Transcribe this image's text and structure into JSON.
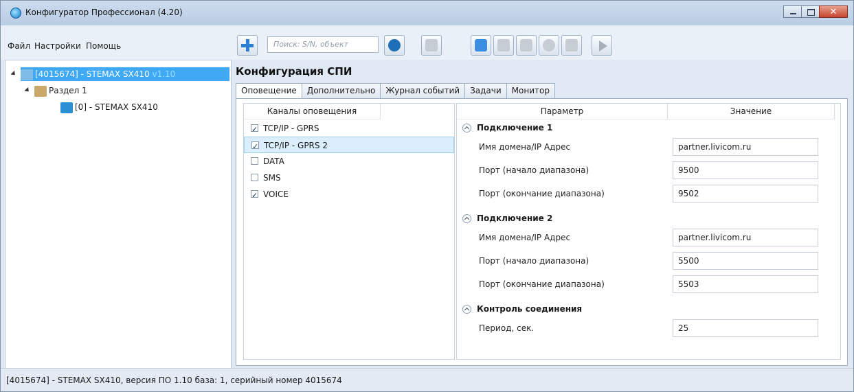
{
  "window": {
    "title": "Конфигуратор Профессионал (4.20)"
  },
  "menu": [
    "Файл",
    "Настройки",
    "Помощь"
  ],
  "toolbar": {
    "search_placeholder": "Поиск: S/N, объект",
    "icons": [
      "add-icon",
      "search-device-icon",
      "users-icon",
      "usb-icon",
      "ethernet-icon",
      "wifi-icon",
      "globe-icon",
      "modem-icon",
      "play-icon"
    ]
  },
  "tree": {
    "device": {
      "label": "[4015674] - STEMAX SX410",
      "version": "v1.10"
    },
    "section": "Раздел 1",
    "object": "[0] - STEMAX SX410"
  },
  "main": {
    "title": "Конфигурация СПИ",
    "tabs": [
      "Оповещение",
      "Дополнительно",
      "Журнал событий",
      "Задачи",
      "Монитор"
    ],
    "active_tab": "Оповещение"
  },
  "channels": {
    "header": "Каналы оповещения",
    "items": [
      {
        "label": "TCP/IP - GPRS",
        "checked": true
      },
      {
        "label": "TCP/IP - GPRS 2",
        "checked": true
      },
      {
        "label": "DATA",
        "checked": false
      },
      {
        "label": "SMS",
        "checked": false
      },
      {
        "label": "VOICE",
        "checked": true
      }
    ],
    "selected": "TCP/IP - GPRS 2"
  },
  "params": {
    "header_param": "Параметр",
    "header_value": "Значение",
    "groups": [
      {
        "title": "Подключение 1",
        "rows": [
          {
            "name": "Имя домена/IP Адрес",
            "value": "partner.livicom.ru"
          },
          {
            "name": "Порт (начало диапазона)",
            "value": "9500"
          },
          {
            "name": "Порт (окончание диапазона)",
            "value": "9502"
          }
        ]
      },
      {
        "title": "Подключение 2",
        "rows": [
          {
            "name": "Имя домена/IP Адрес",
            "value": "partner.livicom.ru"
          },
          {
            "name": "Порт (начало диапазона)",
            "value": "5500"
          },
          {
            "name": "Порт (окончание диапазона)",
            "value": "5503"
          }
        ]
      },
      {
        "title": "Контроль соединения",
        "rows": [
          {
            "name": "Период, сек.",
            "value": "25"
          }
        ]
      }
    ]
  },
  "status": {
    "text": "[4015674] - STEMAX SX410, версия ПО 1.10 база: 1, серийный номер 4015674"
  }
}
